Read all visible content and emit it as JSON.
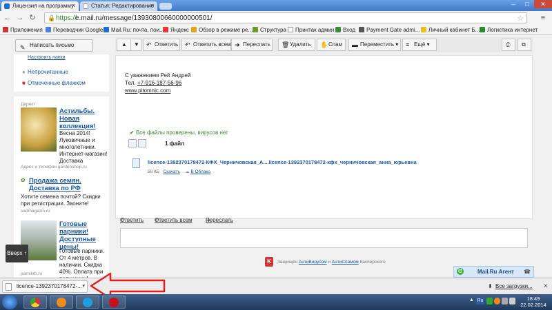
{
  "browser": {
    "tabs": [
      {
        "title": "Лицензия на программу",
        "active": true
      },
      {
        "title": "Статья: Редактирование",
        "active": false
      }
    ],
    "address": {
      "scheme": "https://",
      "rest": "e.mail.ru/message/13930800660000000501/"
    },
    "bookmarks": [
      "Приложения",
      "Переводчик Google",
      "Mail.Ru: почта, пои...",
      "Яндекс",
      "Обзор в режиме ре...",
      "Структура",
      "Принтак админ",
      "Вход",
      "Payment Gate admi...",
      "Личный кабинет Б...",
      "Логистика интернет"
    ]
  },
  "sidebar": {
    "compose": "Написать письмо",
    "settings_link": "Настроить папки",
    "unread": "Непрочитанные",
    "flagged": "Отмеченные флажком"
  },
  "ads": {
    "label": "Директ",
    "items": [
      {
        "title": "Астильбы. Новая коллекция!",
        "text": "Весна 2014! Луковичные и многолетники. Интернет-магазин! Доставка",
        "source": "Адрес и телефон  gardenshop.ru"
      },
      {
        "title": "Продажа семян. Доставка по РФ",
        "text": "Хотите семена почтой? Скидки при регистрации. Звоните!",
        "source": "sadmagazin.ru"
      },
      {
        "title": "Готовые парники! Доступные цены!",
        "text": "Готовые парники. От 4 метров. В наличии. Скидка 40%. Оплата при получении!",
        "source": "parnikrb.ru"
      }
    ]
  },
  "toolbar": {
    "reply": "Ответить",
    "reply_all": "Ответить всем",
    "forward": "Переслать",
    "delete": "Удалить",
    "spam": "Спам",
    "move": "Переместить",
    "more": "Ещё"
  },
  "message": {
    "regards": "С уважением Рей Андрей",
    "phone_label": "Тел.",
    "phone": "+7-916-187-56-96",
    "site": "www.pitomnic.com",
    "virus_check": "Все файлы проверены, вирусов нет",
    "file_count": "1 файл",
    "file_name": "licence-1392370178472-КФХ_Черничовская_А....licence-1392370178472-кфх_черничовская_анна_юрьевна",
    "file_size": "58 КБ",
    "download": "Скачать",
    "to_cloud": "В Облако",
    "actions": {
      "reply": "Ответить",
      "reply_all": "Ответить всем",
      "forward": "Переслать"
    },
    "protection": {
      "prefix": "Защищён",
      "antivirus": "АнтиВирусом",
      "and": "и",
      "antispam": "АнтиСпамом",
      "suffix": "Касперского"
    }
  },
  "float": {
    "up": "Вверх ↑",
    "agent": "Mail.Ru Агент"
  },
  "downloads": {
    "item": "licence-1392370178472-...",
    "all": "Все загрузки..."
  },
  "taskbar": {
    "lang": "Ru",
    "time": "18:49",
    "date": "22.02.2014"
  },
  "colors": {
    "link": "#1a56a8",
    "annotation_arrow": "#e02020",
    "virus_ok": "#3a8a2a"
  }
}
